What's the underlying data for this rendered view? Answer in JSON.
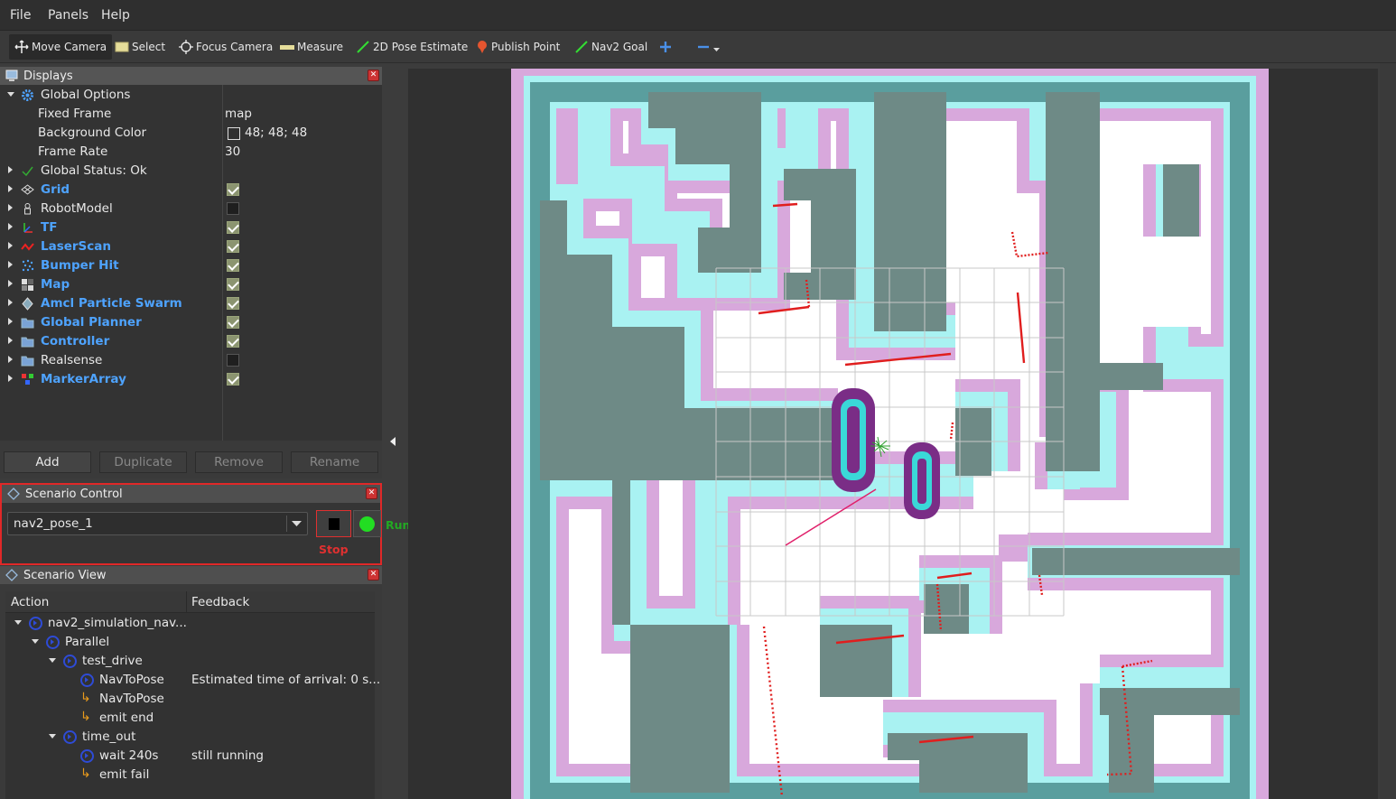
{
  "menubar": {
    "file": "File",
    "panels": "Panels",
    "help": "Help"
  },
  "toolbar": {
    "move_camera": "Move Camera",
    "select": "Select",
    "focus_camera": "Focus Camera",
    "measure": "Measure",
    "pose_estimate": "2D Pose Estimate",
    "publish_point": "Publish Point",
    "nav2_goal": "Nav2 Goal"
  },
  "displays": {
    "title": "Displays",
    "global_options": "Global Options",
    "fixed_frame_label": "Fixed Frame",
    "fixed_frame_value": "map",
    "background_color_label": "Background Color",
    "background_color_value": "48; 48; 48",
    "frame_rate_label": "Frame Rate",
    "frame_rate_value": "30",
    "global_status": "Global Status: Ok",
    "items": [
      {
        "label": "Grid",
        "checked": true,
        "blue": true
      },
      {
        "label": "RobotModel",
        "checked": false,
        "blue": false
      },
      {
        "label": "TF",
        "checked": true,
        "blue": true
      },
      {
        "label": "LaserScan",
        "checked": true,
        "blue": true
      },
      {
        "label": "Bumper Hit",
        "checked": true,
        "blue": true
      },
      {
        "label": "Map",
        "checked": true,
        "blue": true
      },
      {
        "label": "Amcl Particle Swarm",
        "checked": true,
        "blue": true
      },
      {
        "label": "Global Planner",
        "checked": true,
        "blue": true
      },
      {
        "label": "Controller",
        "checked": true,
        "blue": true
      },
      {
        "label": "Realsense",
        "checked": false,
        "blue": false
      },
      {
        "label": "MarkerArray",
        "checked": true,
        "blue": true
      }
    ],
    "buttons": {
      "add": "Add",
      "duplicate": "Duplicate",
      "remove": "Remove",
      "rename": "Rename"
    }
  },
  "scenario_control": {
    "title": "Scenario Control",
    "selected_scenario": "nav2_pose_1",
    "stop_label": "Stop",
    "status": "Running",
    "status_color": "#22cc22",
    "stop_color": "#e03030"
  },
  "scenario_view": {
    "title": "Scenario View",
    "col_action": "Action",
    "col_feedback": "Feedback",
    "root": "nav2_simulation_nav...",
    "parallel": "Parallel",
    "test_drive": "test_drive",
    "nav_to_pose_1": "NavToPose",
    "nav_to_pose_1_feedback": "Estimated time of arrival: 0 s...",
    "nav_to_pose_2": "NavToPose",
    "emit_end": "emit end",
    "time_out": "time_out",
    "wait": "wait 240s",
    "wait_feedback": "still running",
    "emit_fail": "emit fail"
  }
}
